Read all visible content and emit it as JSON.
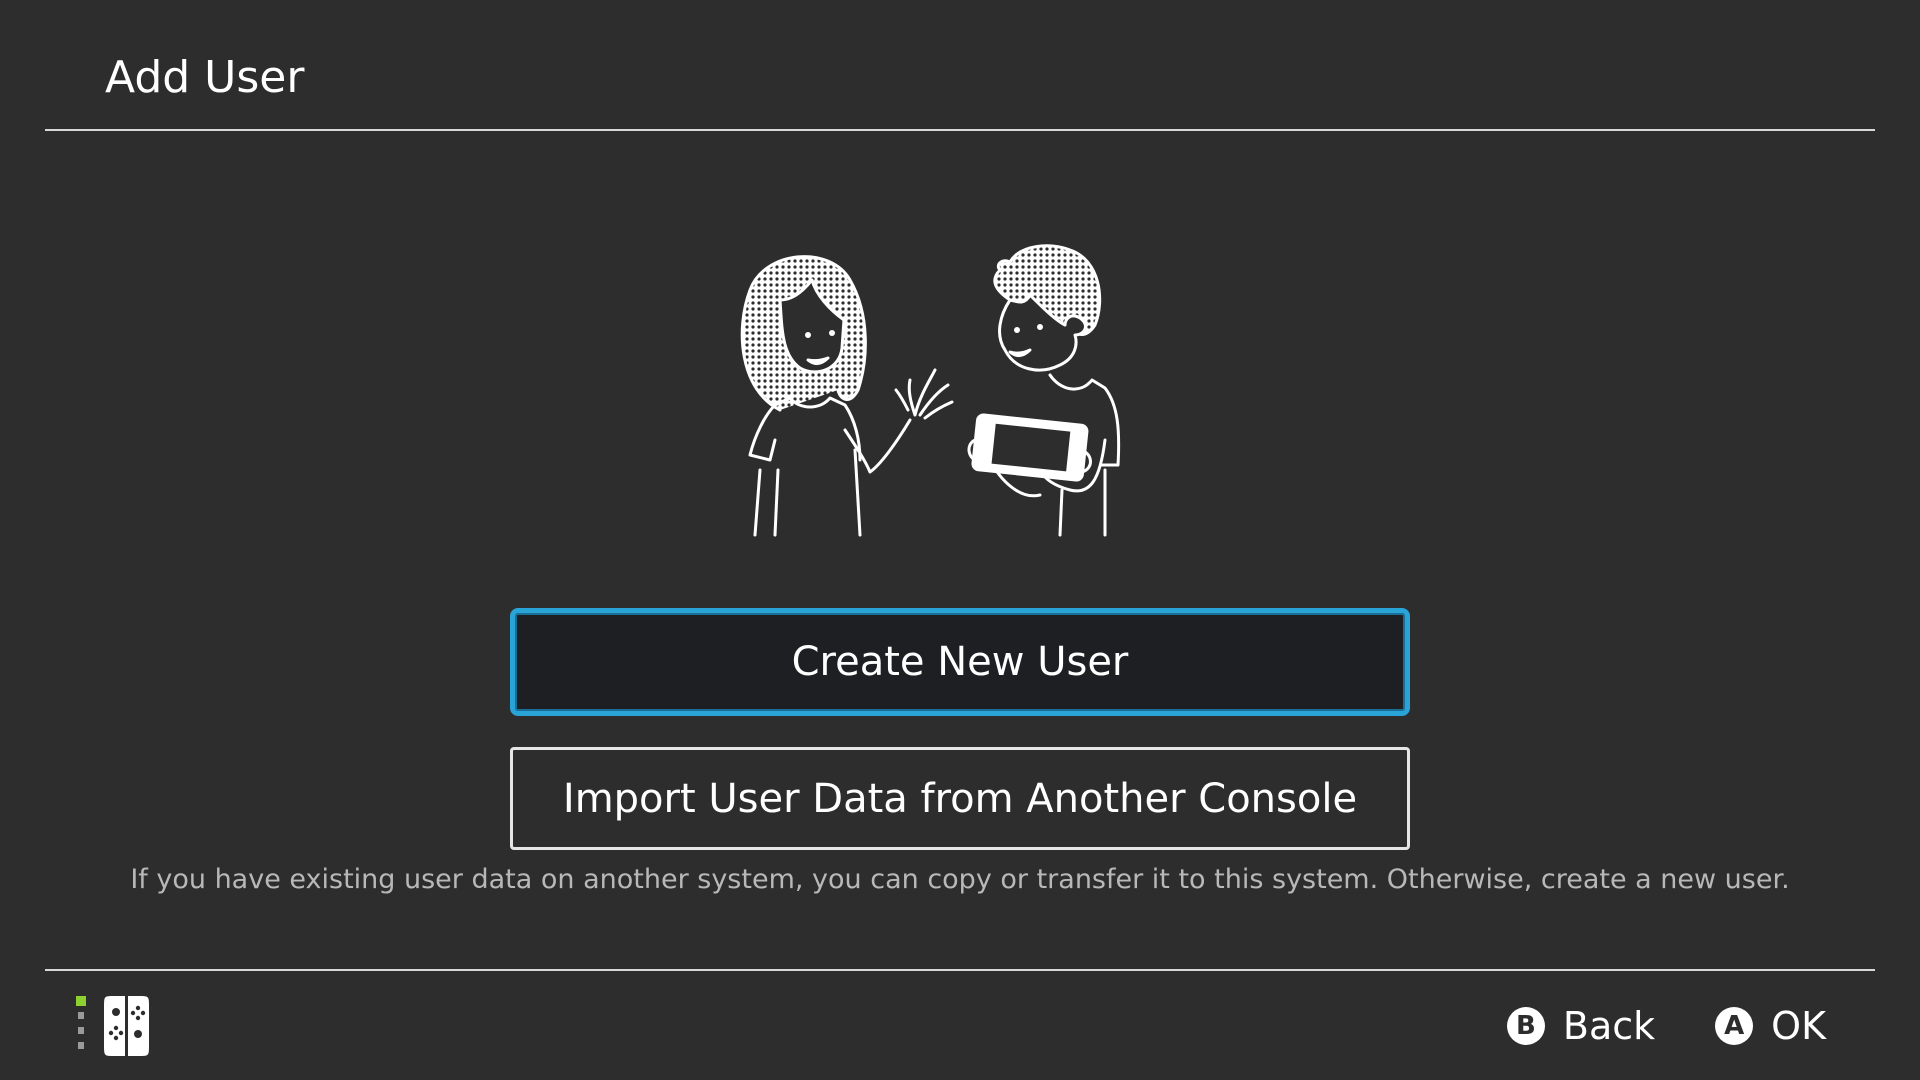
{
  "header": {
    "title": "Add User"
  },
  "illustration": {
    "icon": "two-users-with-console-illustration"
  },
  "actions": {
    "create_new_user": "Create New User",
    "import_user_data": "Import User Data from Another Console"
  },
  "description": "If you have existing user data on another system, you can copy or transfer it to this system. Otherwise, create a new user.",
  "footer": {
    "controller_icon": "joy-con-icon",
    "hints": [
      {
        "glyph": "B",
        "label": "Back"
      },
      {
        "glyph": "A",
        "label": "OK"
      }
    ]
  },
  "colors": {
    "background": "#2d2d2d",
    "focus_border": "#2aa3d6",
    "player_indicator": "#8ed02f"
  }
}
